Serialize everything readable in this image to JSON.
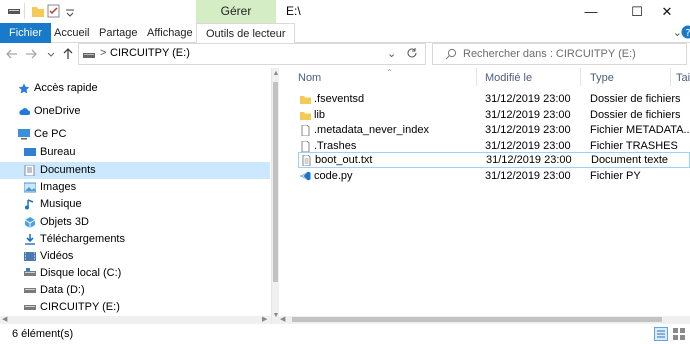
{
  "window": {
    "context_tab": "Gérer",
    "title": "E:\\",
    "controls": {
      "minimize": "—",
      "maximize": "☐",
      "close": "✕"
    }
  },
  "ribbon": {
    "tabs": [
      "Fichier",
      "Accueil",
      "Partage",
      "Affichage",
      "Outils de lecteur"
    ],
    "accent": "#1979ca"
  },
  "address": {
    "path_segments": [
      "CIRCUITPY (E:)"
    ],
    "separator": ">",
    "search_placeholder": "Rechercher dans : CIRCUITPY (E:)"
  },
  "nav": {
    "items": [
      {
        "label": "Accès rapide",
        "icon": "star-icon",
        "color": "#2a7be4"
      },
      {
        "label": "OneDrive",
        "icon": "cloud-icon",
        "color": "#1f7cd8"
      },
      {
        "label": "Ce PC",
        "icon": "computer-icon",
        "color": "#3c8fd9"
      },
      {
        "label": "Bureau",
        "icon": "desktop-icon",
        "color": "#2f80d0"
      },
      {
        "label": "Documents",
        "icon": "documents-icon",
        "color": "#7a8aa0"
      },
      {
        "label": "Images",
        "icon": "pictures-icon",
        "color": "#4a9ad6"
      },
      {
        "label": "Musique",
        "icon": "music-icon",
        "color": "#1e73c8"
      },
      {
        "label": "Objets 3D",
        "icon": "objects3d-icon",
        "color": "#4aa0e0"
      },
      {
        "label": "Téléchargements",
        "icon": "download-icon",
        "color": "#1e73c8"
      },
      {
        "label": "Vidéos",
        "icon": "videos-icon",
        "color": "#4a78b0"
      },
      {
        "label": "Disque local (C:)",
        "icon": "drive-icon",
        "color": "#7a7a7a"
      },
      {
        "label": "Data (D:)",
        "icon": "drive-icon",
        "color": "#7a7a7a"
      },
      {
        "label": "CIRCUITPY (E:)",
        "icon": "drive-icon",
        "color": "#7a7a7a"
      }
    ],
    "selected": "Documents"
  },
  "files": {
    "columns": [
      "Nom",
      "Modifié le",
      "Type",
      "Tail"
    ],
    "rows": [
      {
        "name": ".fseventsd",
        "date": "31/12/2019 23:00",
        "type": "Dossier de fichiers",
        "icon": "folder-icon"
      },
      {
        "name": "lib",
        "date": "31/12/2019 23:00",
        "type": "Dossier de fichiers",
        "icon": "folder-icon"
      },
      {
        "name": ".metadata_never_index",
        "date": "31/12/2019 23:00",
        "type": "Fichier METADATA...",
        "icon": "file-icon"
      },
      {
        "name": ".Trashes",
        "date": "31/12/2019 23:00",
        "type": "Fichier TRASHES",
        "icon": "file-icon"
      },
      {
        "name": "boot_out.txt",
        "date": "31/12/2019 23:00",
        "type": "Document texte",
        "icon": "text-file-icon"
      },
      {
        "name": "code.py",
        "date": "31/12/2019 23:00",
        "type": "Fichier PY",
        "icon": "vscode-file-icon"
      }
    ]
  },
  "status": {
    "count": "6 élément(s)"
  }
}
